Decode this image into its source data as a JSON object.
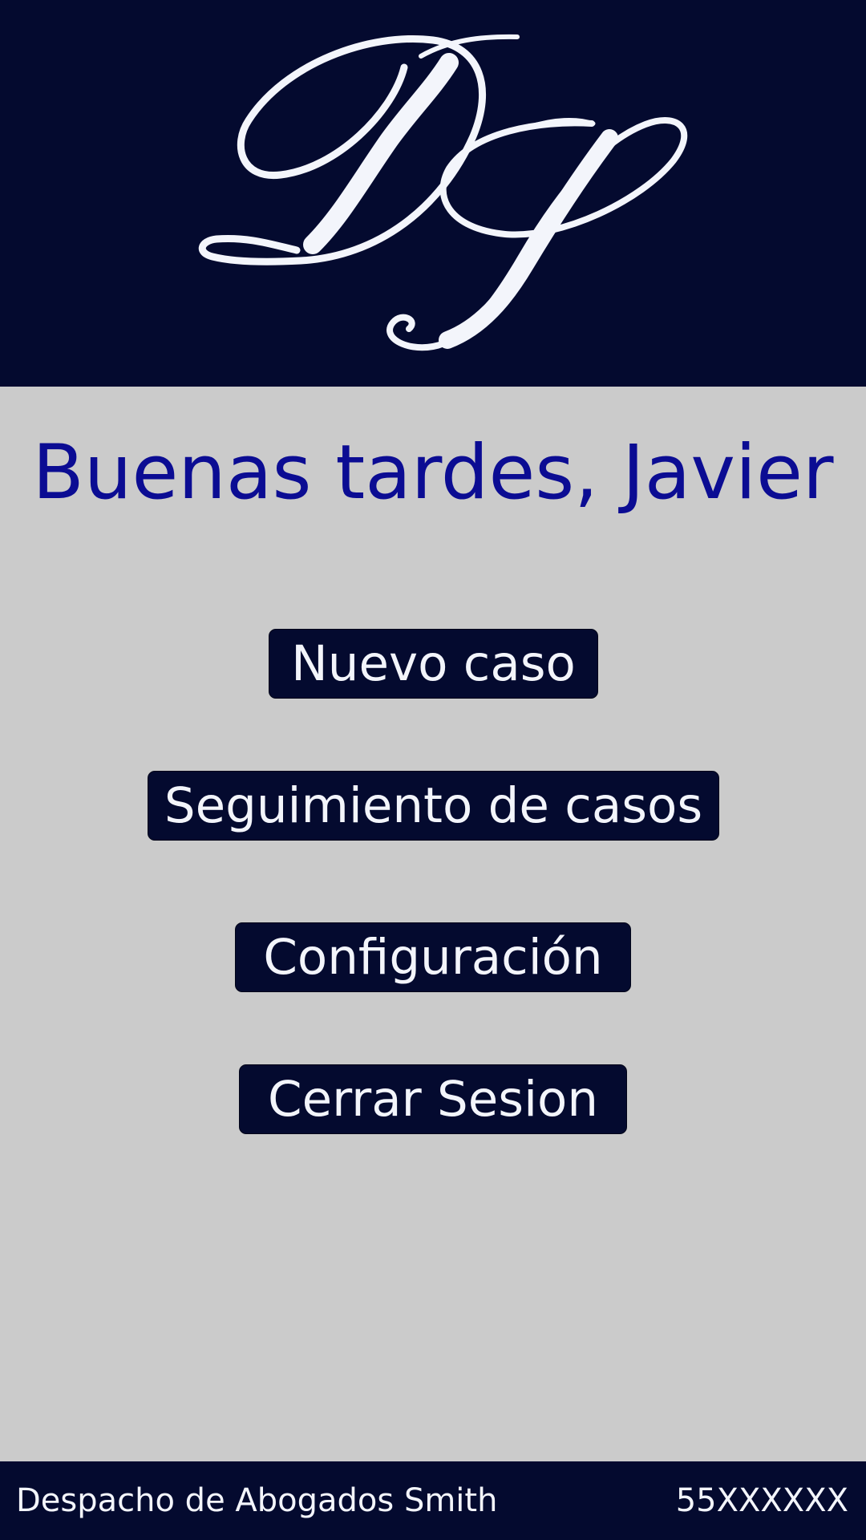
{
  "header": {
    "logo_icon": "dp-monogram-logo",
    "logo_text": "DP",
    "background_color": "#040a2f",
    "logo_color": "#f3f5fb"
  },
  "main": {
    "greeting": "Buenas tardes, Javier",
    "greeting_color": "#0b0c93",
    "background_color": "#cbcbcb",
    "buttons": [
      {
        "label": "Nuevo caso"
      },
      {
        "label": "Seguimiento de casos"
      },
      {
        "label": "Configuración"
      },
      {
        "label": "Cerrar Sesion"
      }
    ]
  },
  "footer": {
    "company": "Despacho de Abogados Smith",
    "phone": "55XXXXXX"
  }
}
